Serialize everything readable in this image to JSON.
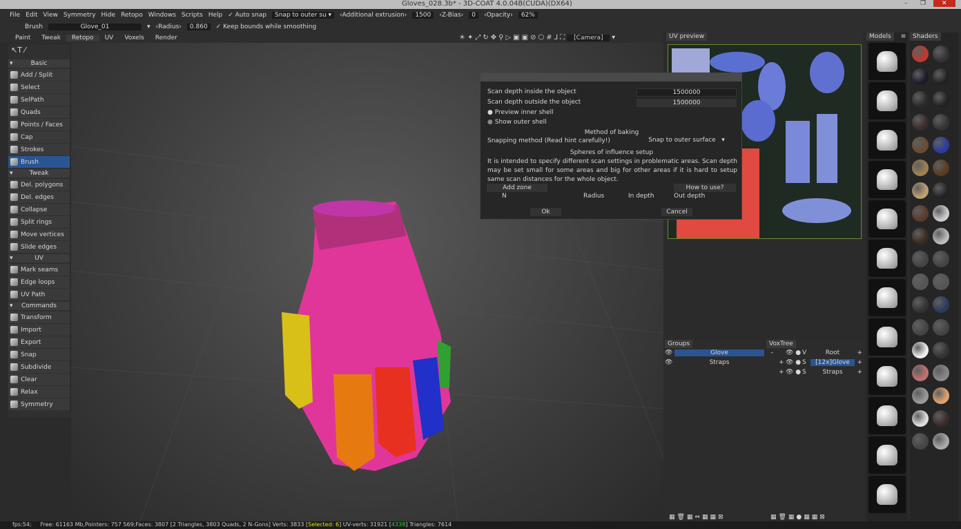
{
  "title": "Gloves_028.3b* - 3D-COAT 4.0.04B(CUDA)(DX64)",
  "menu": [
    "File",
    "Edit",
    "View",
    "Symmetry",
    "Hide",
    "Retopo",
    "Windows",
    "Scripts",
    "Help"
  ],
  "toolbar": {
    "auto_snap": "Auto snap",
    "snap_mode": "Snap to outer su",
    "extrusion_label": "‹Additional extrusion›",
    "extrusion": "1500",
    "zbias_label": "‹Z-Bias›",
    "zbias": "0",
    "opacity_label": "‹Opacity›",
    "opacity": "62%"
  },
  "row2": {
    "tool": "Brush",
    "object": "Glove_01",
    "radius_label": "‹Radius›",
    "radius": "0.860",
    "keep_bounds": "Keep bounds while smoothing"
  },
  "tabs": [
    "Paint",
    "Tweak",
    "Retopo",
    "UV",
    "Voxels",
    "Render"
  ],
  "active_tab": "Retopo",
  "camera": "[Camera]",
  "left": {
    "sections": [
      {
        "title": "Basic",
        "items": [
          "Add / Split",
          "Select",
          "SelPath",
          "Quads",
          "Points / Faces",
          "Cap",
          "Strokes",
          "Brush"
        ]
      },
      {
        "title": "Tweak",
        "items": [
          "Del. polygons",
          "Del. edges",
          "Collapse",
          "Split rings",
          "Move vertices",
          "Slide edges"
        ]
      },
      {
        "title": "UV",
        "items": [
          "Mark seams",
          "Edge loops",
          "UV Path"
        ]
      },
      {
        "title": "Commands",
        "items": [
          "Transform",
          "Import",
          "Export",
          "Snap",
          "Subdivide",
          "Clear",
          "Relax",
          "Symmetry"
        ]
      }
    ],
    "selected": "Brush"
  },
  "dialog": {
    "scan_in_label": "Scan depth inside the object",
    "scan_in": "1500000",
    "scan_out_label": "Scan depth outside the object",
    "scan_out": "1500000",
    "preview_inner": "Preview inner shell",
    "show_outer": "Show outer shell",
    "method_title": "Method of baking",
    "snapping_label": "Snapping method (Read hint carefully!)",
    "snapping": "Snap to outer surface",
    "spheres_title": "Spheres of influence setup",
    "hint": "It is intended to specify different scan settings in problematic areas. Scan depth may be set small for some areas and big for other areas if it is hard to setup same scan distances for the whole object.",
    "add_zone": "Add zone",
    "how_to": "How to use?",
    "cols": [
      "N",
      "Radius",
      "In depth",
      "Out depth"
    ],
    "ok": "Ok",
    "cancel": "Cancel"
  },
  "uv_preview": "UV preview",
  "groups": {
    "title": "Groups",
    "items": [
      "Glove",
      "Straps"
    ],
    "selected": "Glove"
  },
  "voxtree": {
    "title": "VoxTree",
    "items": [
      {
        "flag": "V",
        "name": "Root"
      },
      {
        "flag": "S",
        "name": "[12x]Glove"
      },
      {
        "flag": "S",
        "name": "Straps"
      }
    ],
    "selected": "[12x]Glove"
  },
  "models_title": "Models",
  "shaders_title": "Shaders",
  "status": {
    "fps": "fps:54;",
    "a": "Free: 61163 Mb,Pointers: 757 569;Faces: 3807 [2 Triangles, 3803 Quads, 2 N-Gons] Verts: 3833 [",
    "selected": "Selected: 6",
    "b": "] UV-verts: 31921 [",
    "uvsel": "4338",
    "c": "] Triangles: 7614"
  },
  "colors": {
    "selection": "#2a5593",
    "accent_green": "#6a8a30"
  }
}
